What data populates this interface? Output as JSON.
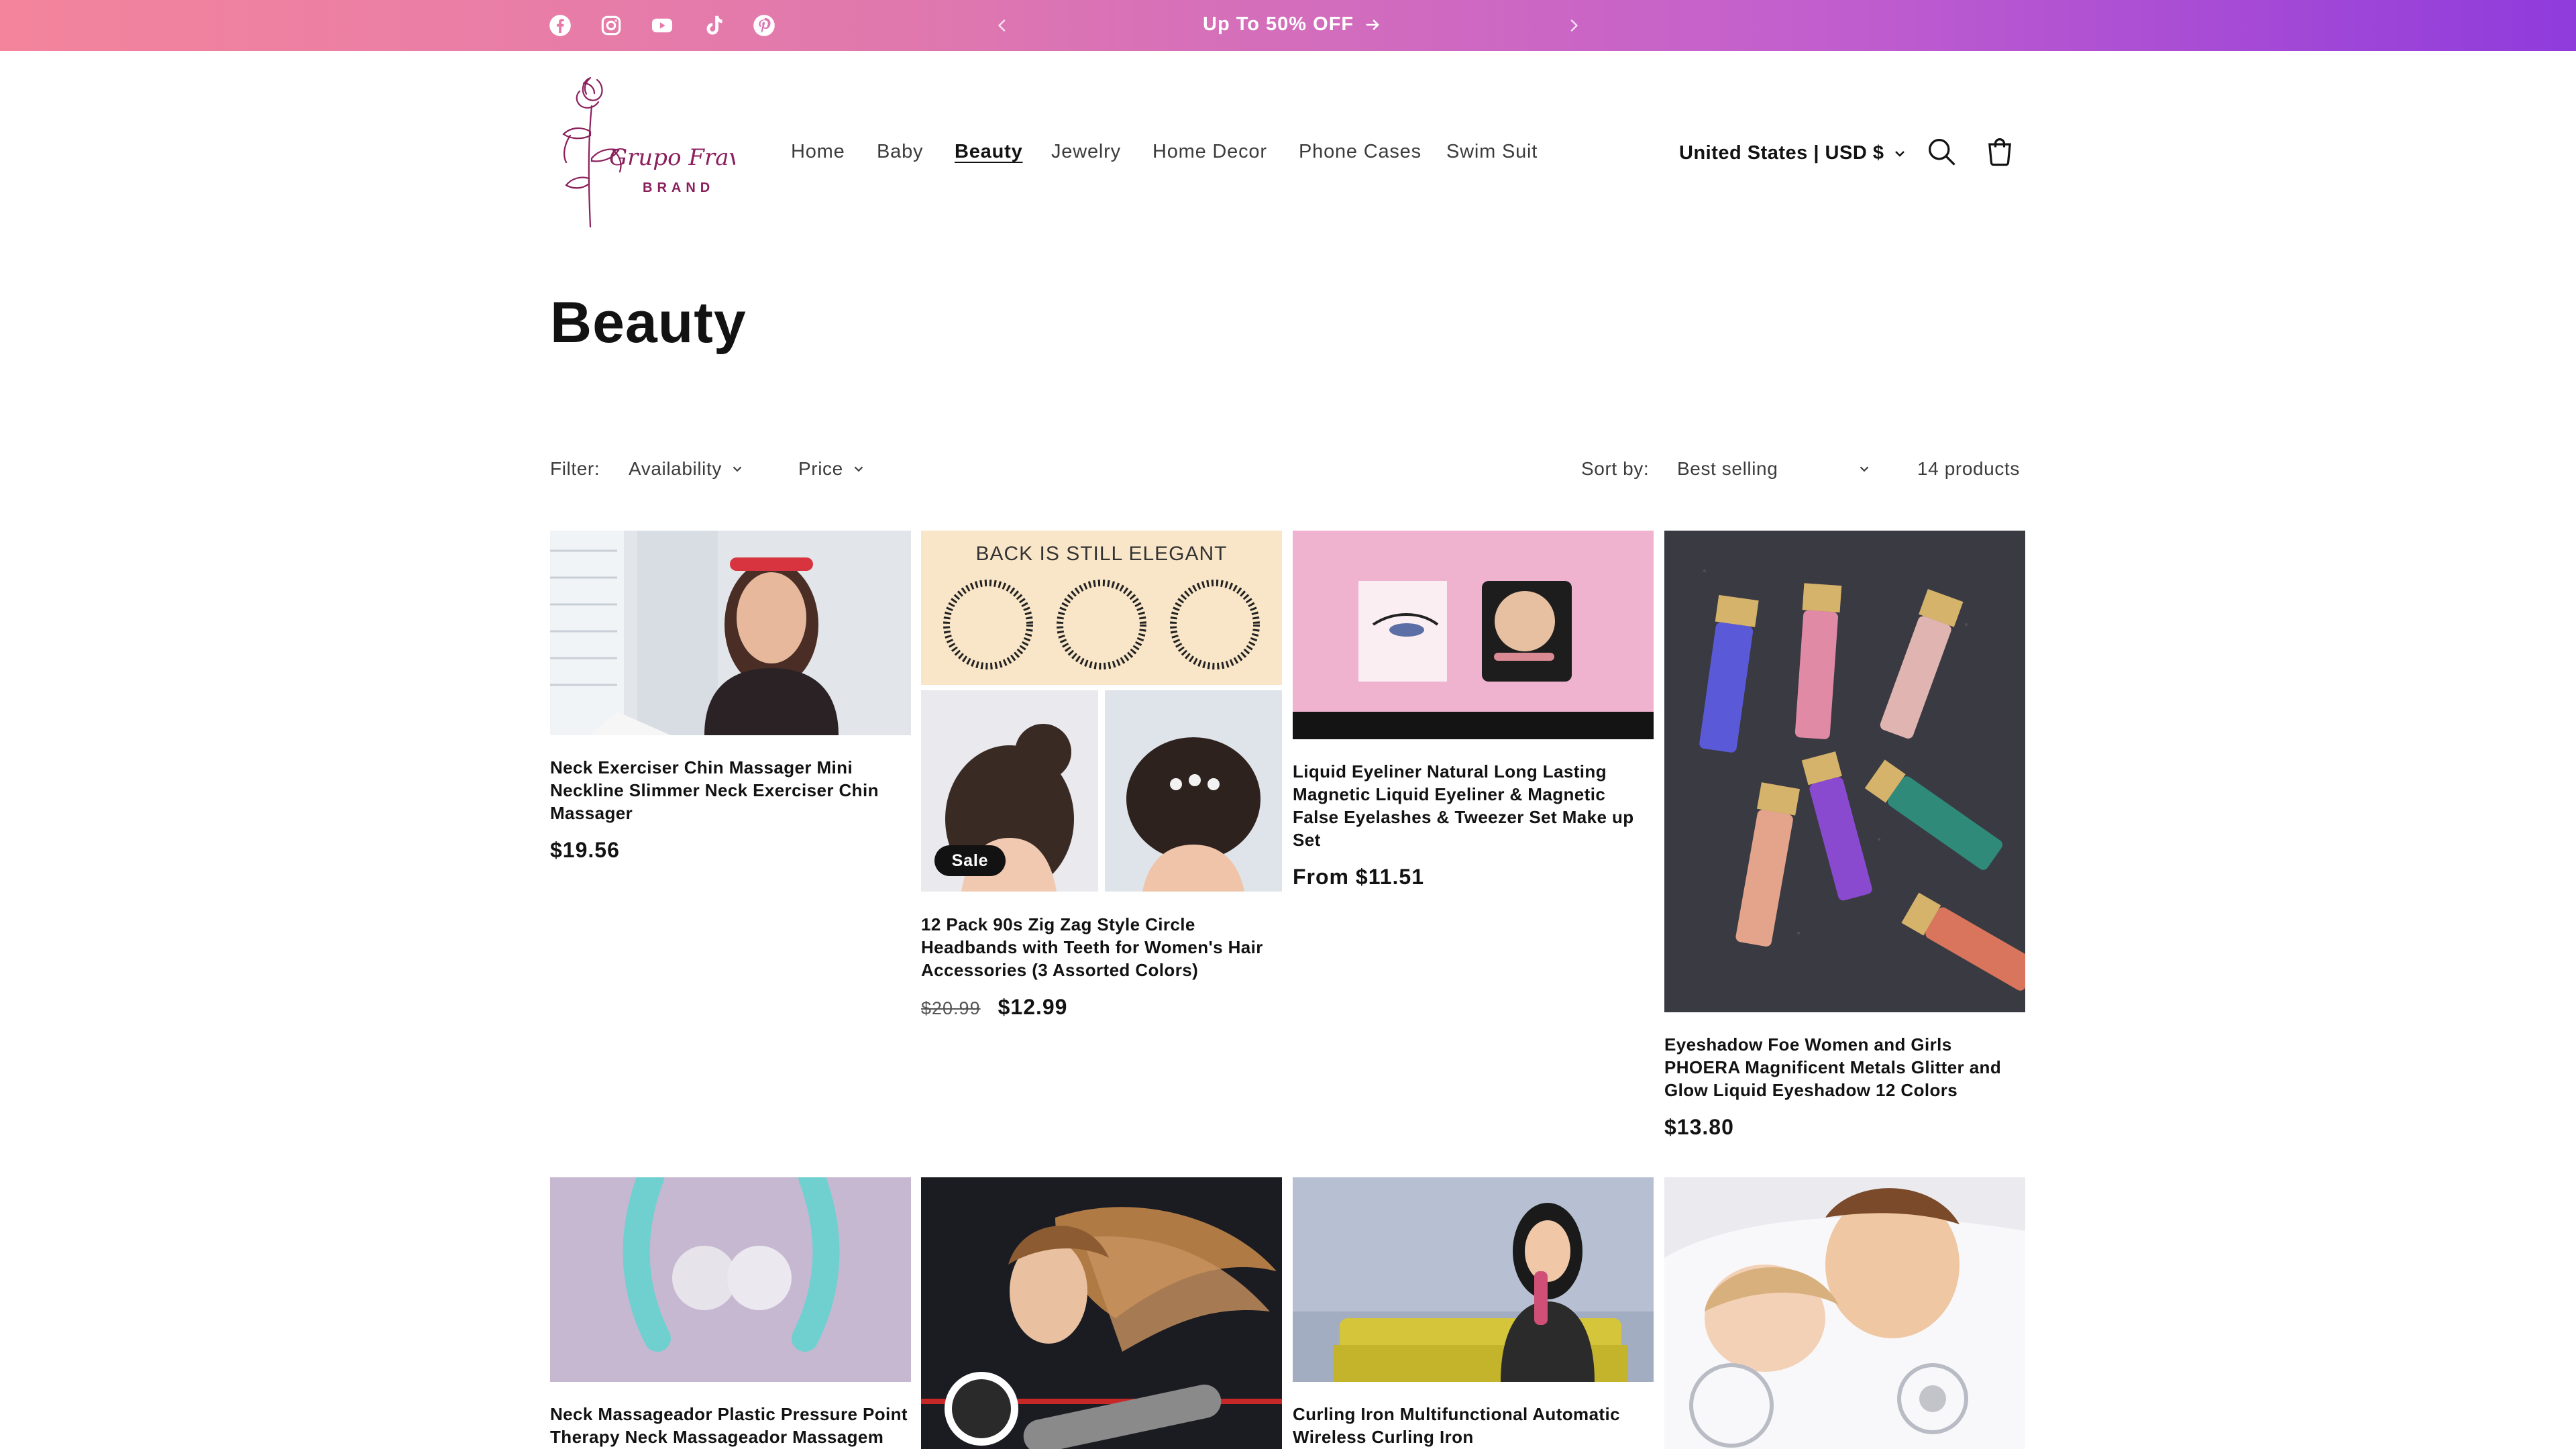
{
  "announcement": {
    "text": "Up To 50% OFF",
    "social_icons": [
      "facebook-icon",
      "instagram-icon",
      "youtube-icon",
      "tiktok-icon",
      "pinterest-icon"
    ]
  },
  "header": {
    "logo_text": "Grupo Fravas",
    "logo_subtext": "BRAND",
    "nav": [
      "Home",
      "Baby",
      "Beauty",
      "Jewelry",
      "Home Decor",
      "Phone Cases",
      "Swim Suit"
    ],
    "active_nav": "Beauty",
    "locale": "United States | USD $"
  },
  "page": {
    "title": "Beauty"
  },
  "filters": {
    "label": "Filter:",
    "availability": "Availability",
    "price": "Price",
    "sort_label": "Sort by:",
    "sort_value": "Best selling",
    "count": "14 products"
  },
  "products": [
    {
      "title": "Neck Exerciser Chin Massager Mini Neckline Slimmer Neck Exerciser Chin Massager",
      "price": "$19.56"
    },
    {
      "title": "12 Pack 90s Zig Zag Style Circle Headbands with Teeth for Women's Hair Accessories (3 Assorted Colors)",
      "price_old": "$20.99",
      "price": "$12.99",
      "badge": "Sale",
      "image_text": "BACK IS STILL ELEGANT"
    },
    {
      "title": "Liquid Eyeliner Natural Long Lasting Magnetic Liquid Eyeliner & Magnetic False Eyelashes & Tweezer Set Make up Set",
      "price": "From $11.51"
    },
    {
      "title": "Eyeshadow Foe Women and Girls PHOERA Magnificent Metals Glitter and Glow Liquid Eyeshadow 12 Colors",
      "price": "$13.80"
    },
    {
      "title": "Neck Massageador Plastic Pressure Point Therapy Neck Massageador Massagem"
    },
    {
      "title": ""
    },
    {
      "title": "Curling Iron Multifunctional Automatic Wireless Curling Iron"
    },
    {
      "title": ""
    }
  ],
  "colors": {
    "announcement_start": "#f4849c",
    "announcement_end": "#8f3bdc",
    "text": "#121212",
    "logo_accent": "#8a1f5c"
  }
}
